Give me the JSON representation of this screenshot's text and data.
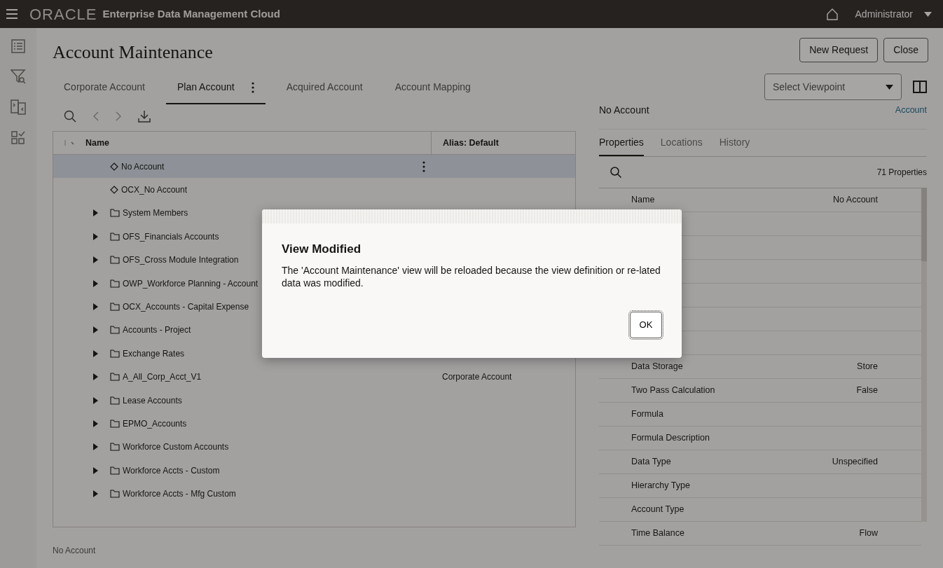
{
  "header": {
    "brand": "ORACLE",
    "product": "Enterprise Data Management Cloud",
    "user": "Administrator"
  },
  "title": "Account Maintenance",
  "actions": [
    "New Request",
    "Close"
  ],
  "view_tabs": [
    {
      "label": "Corporate Account",
      "selected": false
    },
    {
      "label": "Plan Account",
      "selected": true
    },
    {
      "label": "Acquired Account",
      "selected": false
    },
    {
      "label": "Account Mapping",
      "selected": false
    }
  ],
  "tree": {
    "columns": [
      "Name",
      "Alias: Default"
    ],
    "rows": [
      {
        "kind": "member",
        "name": "No Account",
        "selected": true
      },
      {
        "kind": "member",
        "name": "OCX_No Account",
        "selected": false
      },
      {
        "kind": "folder",
        "name": "System Members",
        "selected": false
      },
      {
        "kind": "folder",
        "name": "OFS_Financials Accounts",
        "selected": false
      },
      {
        "kind": "folder",
        "name": "OFS_Cross Module Integration",
        "selected": false
      },
      {
        "kind": "folder",
        "name": "OWP_Workforce Planning - Account",
        "selected": false
      },
      {
        "kind": "folder",
        "name": "OCX_Accounts - Capital Expense",
        "selected": false
      },
      {
        "kind": "folder",
        "name": "Accounts - Project",
        "selected": false
      },
      {
        "kind": "folder",
        "name": "Exchange Rates",
        "selected": false
      },
      {
        "kind": "folder",
        "name": "A_All_Corp_Acct_V1",
        "alias": "Corporate Account",
        "selected": false
      },
      {
        "kind": "folder",
        "name": "Lease Accounts",
        "selected": false
      },
      {
        "kind": "folder",
        "name": "EPMO_Accounts",
        "selected": false
      },
      {
        "kind": "folder",
        "name": "Workforce Custom Accounts",
        "selected": false
      },
      {
        "kind": "folder",
        "name": "Workforce Accts - Custom",
        "selected": false
      },
      {
        "kind": "folder",
        "name": "Workforce Accts - Mfg Custom",
        "selected": false
      }
    ]
  },
  "status": "No Account",
  "viewpoint_select": {
    "placeholder": "Select Viewpoint"
  },
  "detail": {
    "node": "No Account",
    "type_link": "Account",
    "tabs": [
      {
        "label": "Properties",
        "selected": true
      },
      {
        "label": "Locations",
        "selected": false
      },
      {
        "label": "History",
        "selected": false
      }
    ],
    "count": "71 Properties",
    "properties": [
      {
        "label": "Name",
        "value": "No Account"
      },
      {
        "label": "Data Storage",
        "value": "Store"
      },
      {
        "label": "Two Pass Calculation",
        "value": "False"
      },
      {
        "label": "Formula"
      },
      {
        "label": "Formula Description"
      },
      {
        "label": "Data Type",
        "value": "Unspecified"
      },
      {
        "label": "Hierarchy Type"
      },
      {
        "label": "Account Type"
      },
      {
        "label": "Time Balance",
        "value": "Flow"
      }
    ]
  },
  "dialog": {
    "title": "View Modified",
    "message": "The 'Account Maintenance' view will be reloaded because the view definition or re-lated data was modified.",
    "button": "OK"
  }
}
